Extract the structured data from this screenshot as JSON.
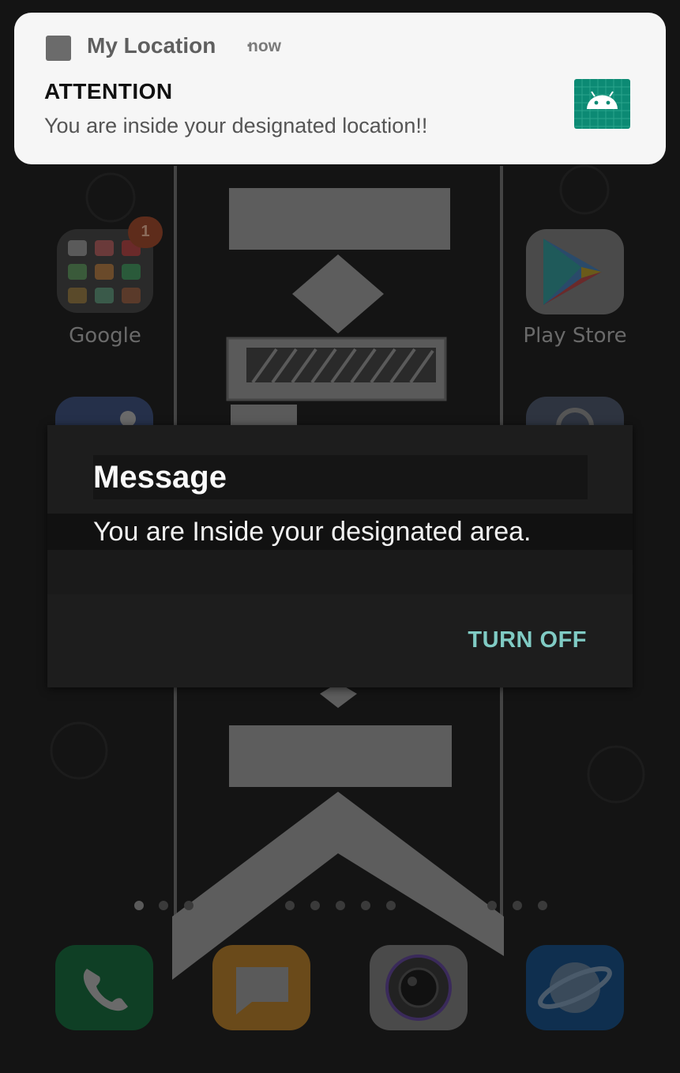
{
  "notification": {
    "app_name": "My Location",
    "separator": "·",
    "time": "now",
    "title": "ATTENTION",
    "text": "You are inside your designated location!!",
    "app_icon": "app-icon",
    "large_icon": "android-icon"
  },
  "home": {
    "folder_label": "Google",
    "folder_badge": "1",
    "play_store_label": "Play Store",
    "page_dots_count": 11,
    "active_page": 0,
    "dock": [
      "phone-icon",
      "messages-icon",
      "camera-icon",
      "browser-icon"
    ]
  },
  "dialog": {
    "title": "Message",
    "message": "You are Inside your designated area.",
    "button_label": "TURN OFF"
  },
  "colors": {
    "accent": "#80cbc4",
    "notification_icon_bg": "#0c8a74",
    "dialog_bg": "#1d1d1d"
  }
}
